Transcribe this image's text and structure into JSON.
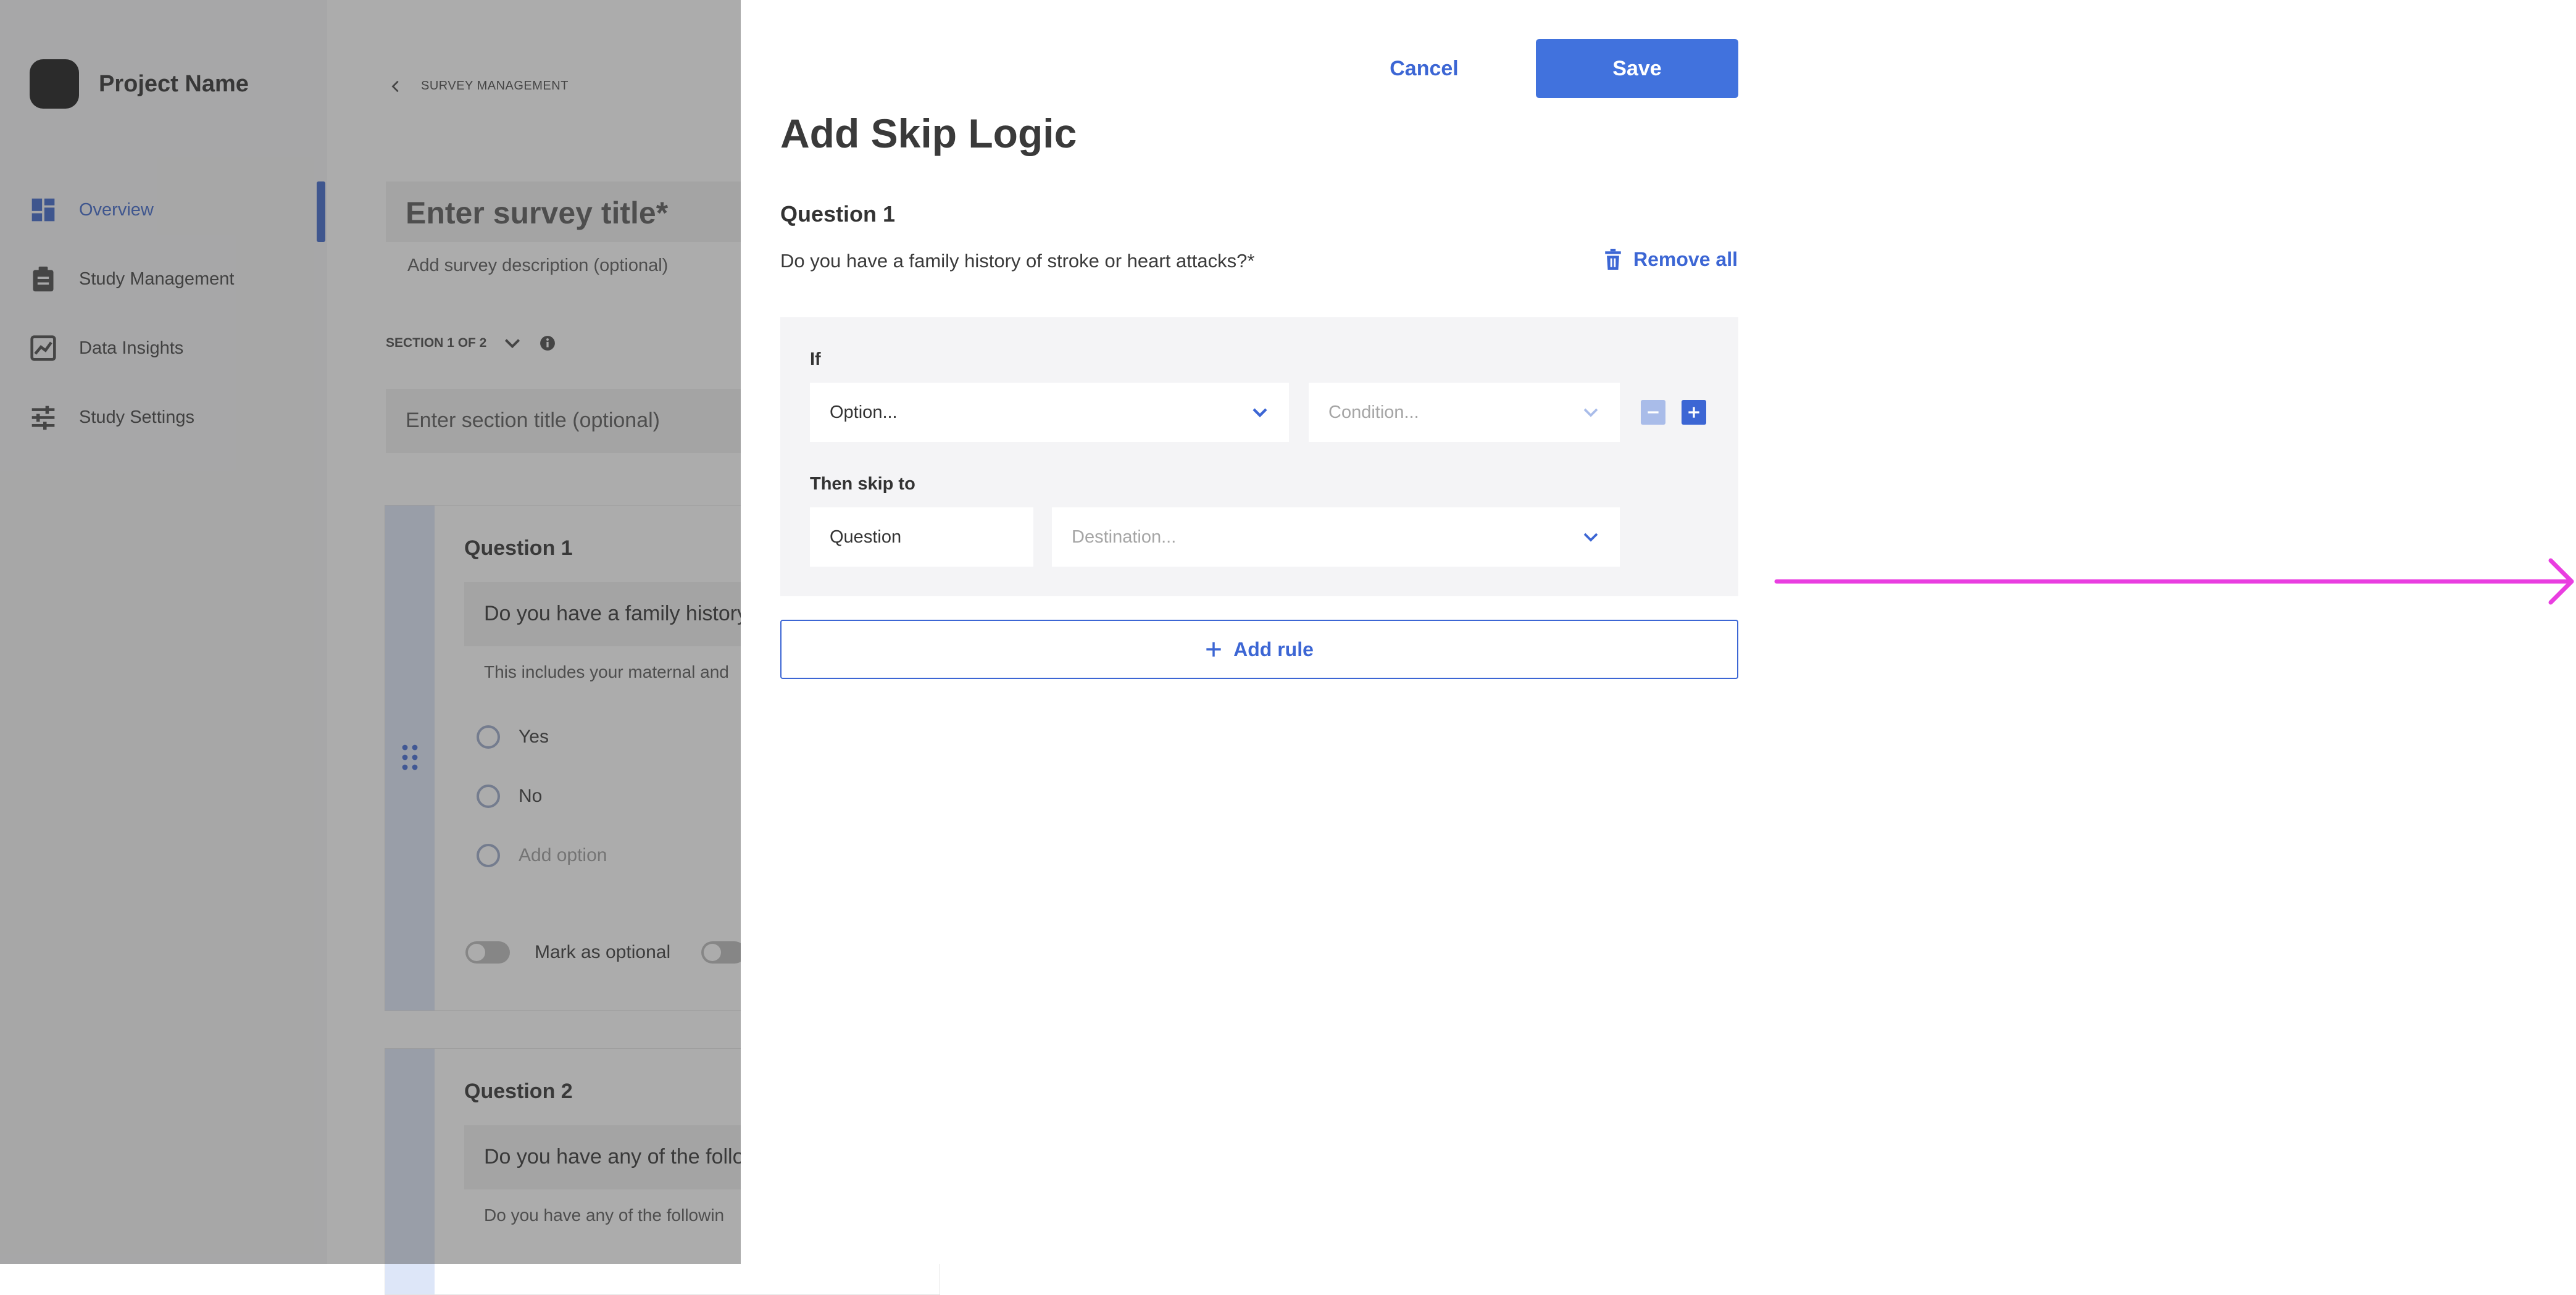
{
  "sidebar": {
    "project_name": "Project Name",
    "items": [
      {
        "label": "Overview",
        "icon": "dashboard-icon",
        "active": true
      },
      {
        "label": "Study Management",
        "icon": "clipboard-icon",
        "active": false
      },
      {
        "label": "Data Insights",
        "icon": "chart-icon",
        "active": false
      },
      {
        "label": "Study Settings",
        "icon": "sliders-icon",
        "active": false
      }
    ]
  },
  "editor": {
    "breadcrumb": "SURVEY MANAGEMENT",
    "title_placeholder": "Enter survey title*",
    "description_placeholder": "Add survey description (optional)",
    "section_indicator": "SECTION 1 OF 2",
    "section_title_placeholder": "Enter section title (optional)",
    "questions": [
      {
        "label": "Question 1",
        "text": "Do you have a family history",
        "hint": "This includes your maternal and",
        "options": [
          "Yes",
          "No"
        ],
        "add_option": "Add option",
        "optional_toggle": "Mark as optional"
      },
      {
        "label": "Question 2",
        "text": "Do you have any of the follo",
        "hint": "Do you have any of the followin"
      }
    ]
  },
  "modal": {
    "cancel_label": "Cancel",
    "save_label": "Save",
    "title": "Add Skip Logic",
    "question_label": "Question 1",
    "question_text": "Do you have a family history of stroke or heart attacks?*",
    "remove_all_label": "Remove all",
    "rule": {
      "if_label": "If",
      "option_value": "Option...",
      "condition_placeholder": "Condition...",
      "then_label": "Then skip to",
      "target_type": "Question",
      "destination_placeholder": "Destination..."
    },
    "add_rule_label": "Add rule"
  },
  "colors": {
    "accent": "#3c66d4",
    "save_button": "#4172dd",
    "annotation_arrow": "#e93ee0"
  }
}
